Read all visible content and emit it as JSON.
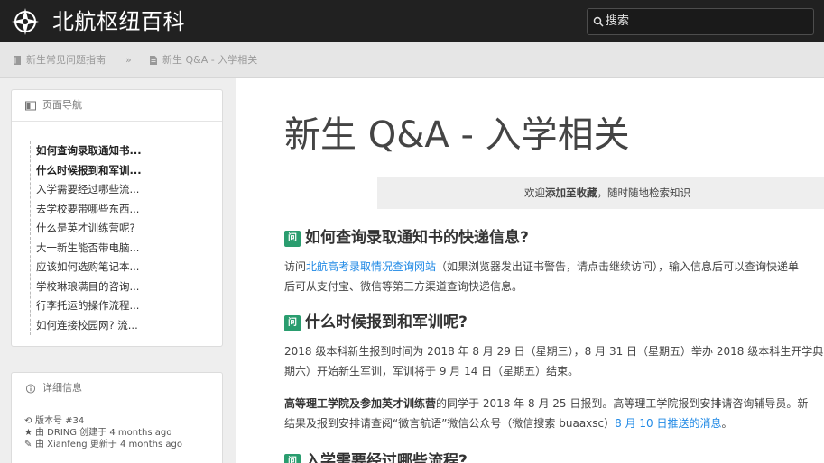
{
  "navbar": {
    "brand": "北航枢纽百科",
    "logo_icon": "compass-star-logo",
    "search_label": "搜索"
  },
  "breadcrumb": {
    "items": [
      "新生常见问题指南",
      "新生 Q&A - 入学相关"
    ],
    "separator": "»"
  },
  "sidebar": {
    "nav_title": "页面导航",
    "toc": [
      {
        "label": "如何查询录取通知书...",
        "active": true
      },
      {
        "label": "什么时候报到和军训...",
        "active": true
      },
      {
        "label": "入学需要经过哪些流...",
        "active": false
      },
      {
        "label": "去学校要带哪些东西...",
        "active": false
      },
      {
        "label": "什么是英才训练营呢?",
        "active": false
      },
      {
        "label": "大一新生能否带电脑...",
        "active": false
      },
      {
        "label": "应该如何选购笔记本...",
        "active": false
      },
      {
        "label": "学校琳琅满目的咨询...",
        "active": false
      },
      {
        "label": "行李托运的操作流程...",
        "active": false
      },
      {
        "label": "如何连接校园网? 流...",
        "active": false
      }
    ],
    "info_title": "详细信息",
    "info": {
      "version": "版本号 #34",
      "created": "由 DRING 创建于 4 months ago",
      "updated": "由 Xianfeng 更新于 4 months ago"
    }
  },
  "main": {
    "title": "新生 Q&A - 入学相关",
    "notice": {
      "pre": "欢迎",
      "bold": "添加至收藏",
      "post": "，随时随地检索知识"
    },
    "badge": "问",
    "sections": [
      {
        "heading": "如何查询录取通知书的快递信息?",
        "p1_pre": "访问",
        "p1_link": "北航高考录取情况查询网站",
        "p1_post": "（如果浏览器发出证书警告，请点击继续访问），输入信息后可以查询快递单",
        "p2": "后可从支付宝、微信等第三方渠道查询快递信息。"
      },
      {
        "heading": "什么时候报到和军训呢?",
        "p1": "2018 级本科新生报到时间为 2018 年 8 月 29 日（星期三），8 月 31 日（星期五）举办 2018 级本科生开学典",
        "p2": "期六）开始新生军训，军训将于 9 月 14 日（星期五）结束。",
        "p3_bold": "高等理工学院及参加英才训练营",
        "p3_post": "的同学于 2018 年 8 月 25 日报到。高等理工学院报到安排请咨询辅导员。新",
        "p4_pre": "结果及报到安排请查阅“微言航语”微信公众号（微信搜索 buaaxsc）",
        "p4_link": "8 月 10 日推送的消息",
        "p4_post": "。"
      },
      {
        "heading": "入学需要经过哪些流程?"
      }
    ]
  }
}
